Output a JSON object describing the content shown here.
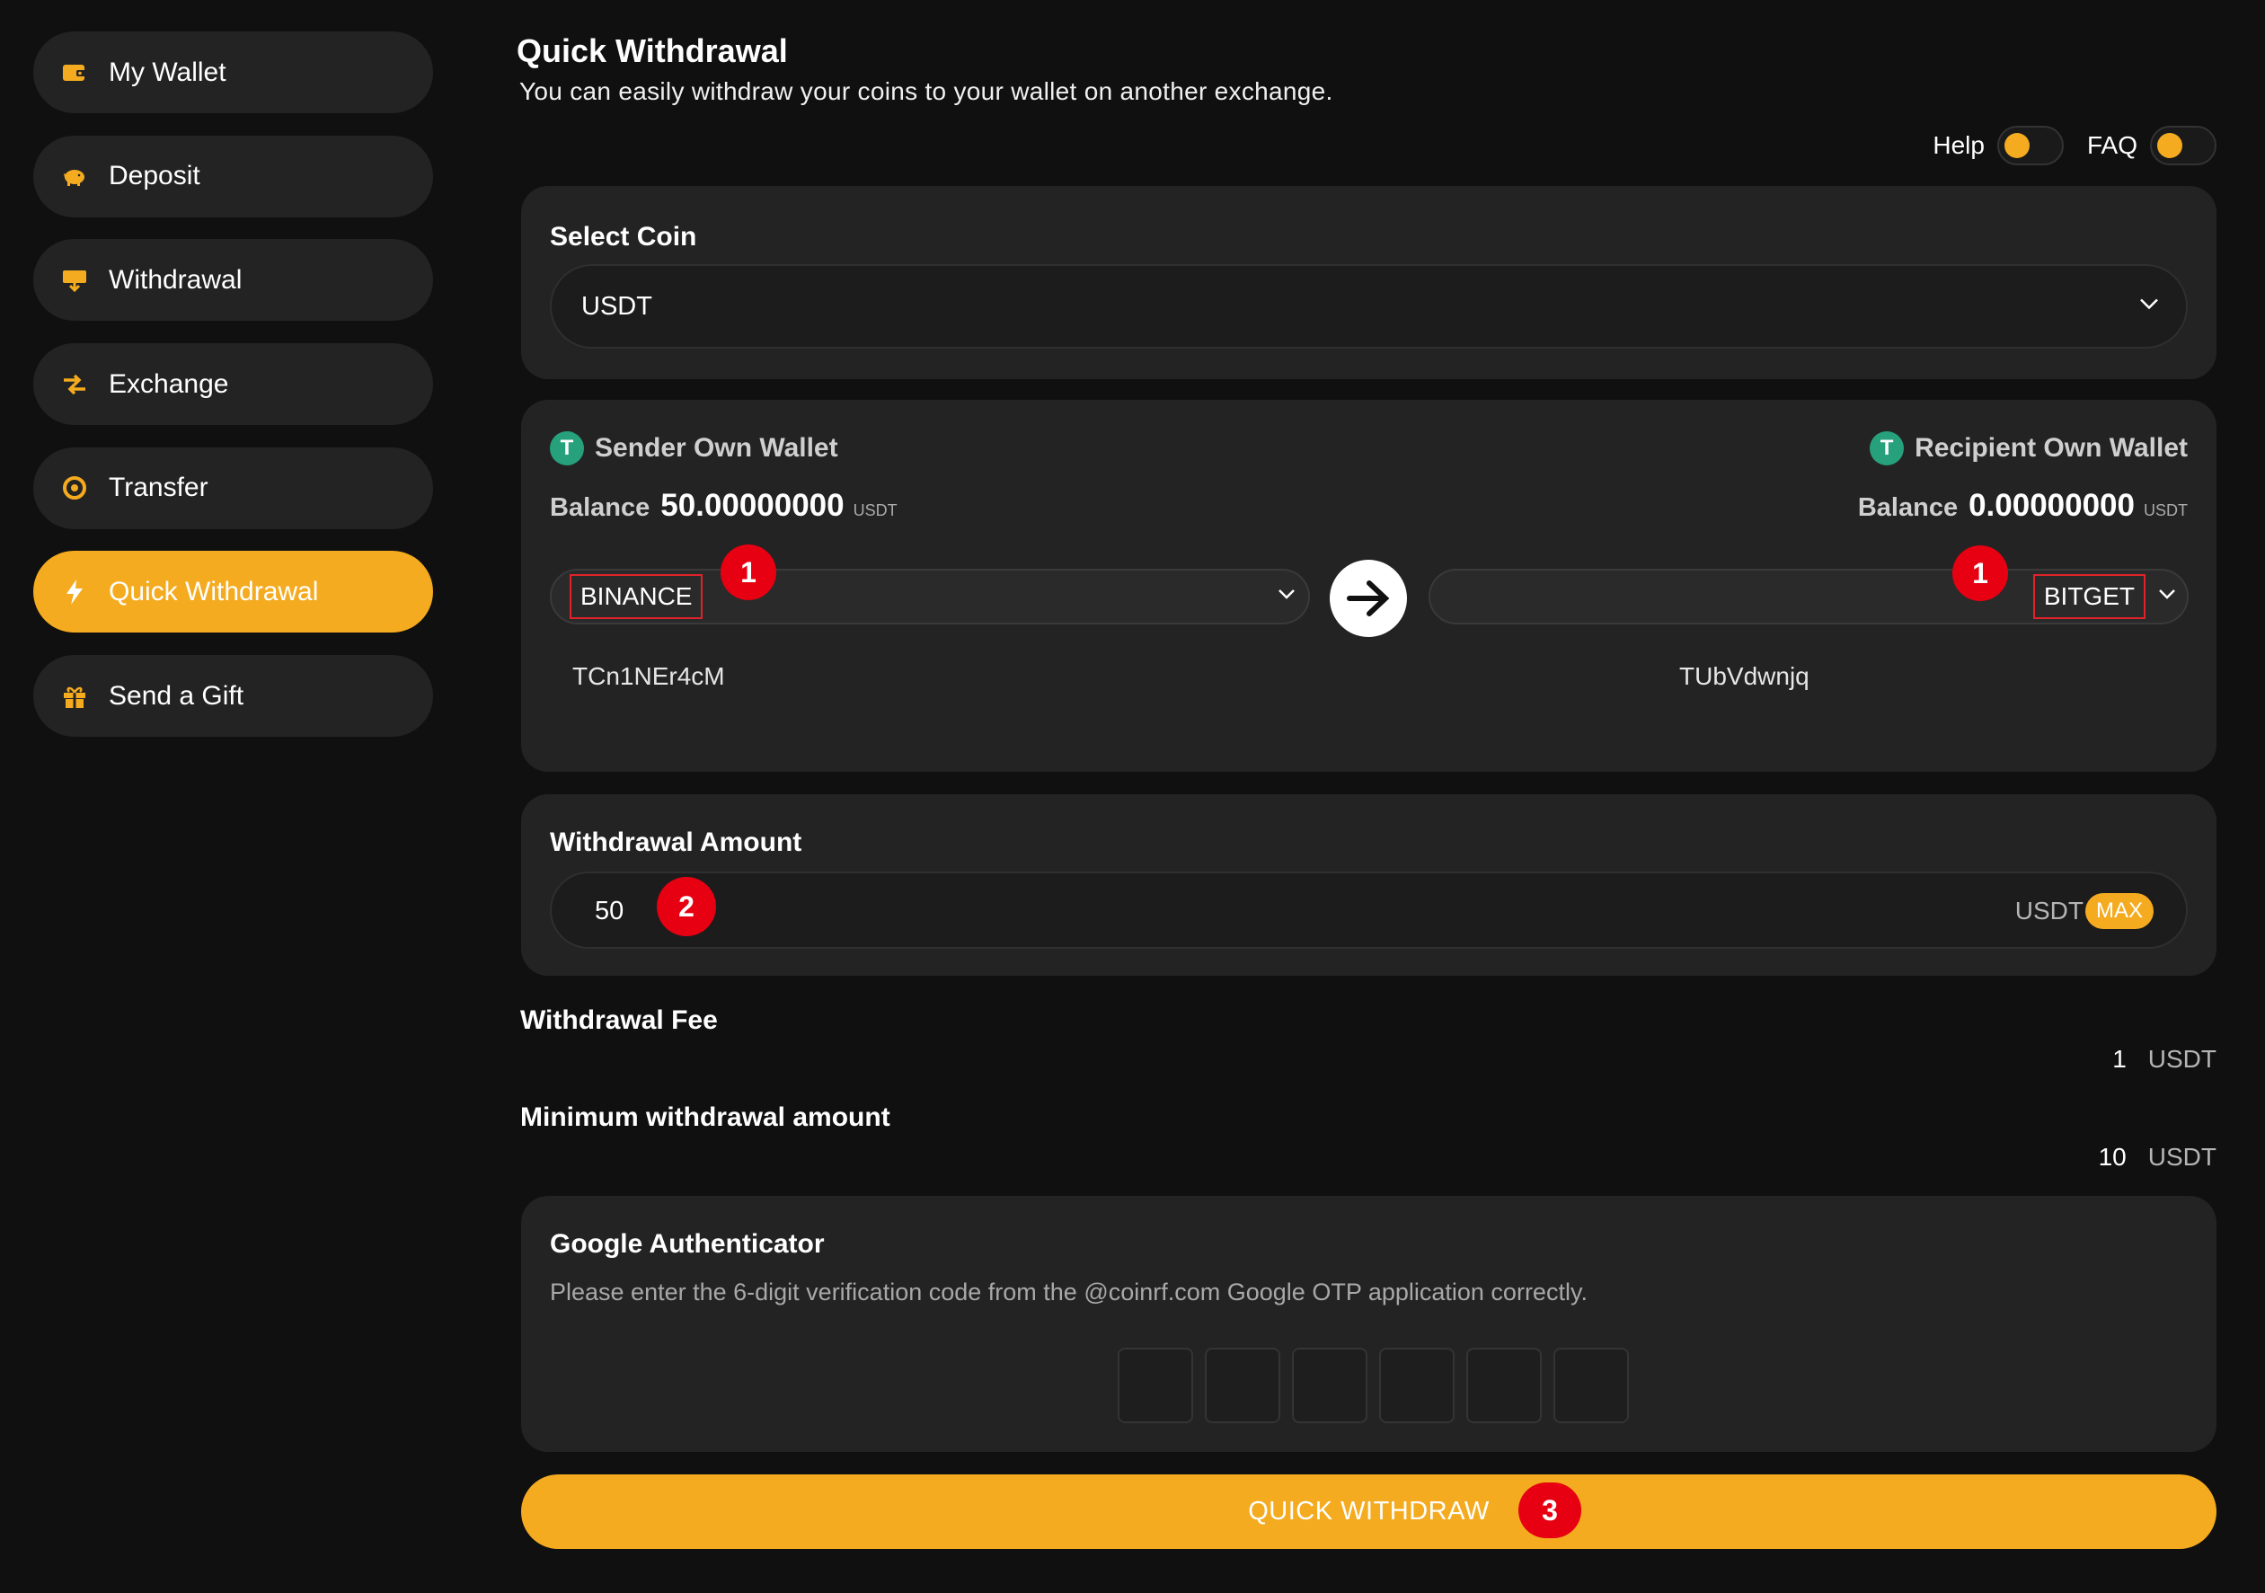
{
  "sidebar": {
    "items": [
      {
        "label": "My Wallet",
        "icon": "wallet-icon"
      },
      {
        "label": "Deposit",
        "icon": "piggy-bank-icon"
      },
      {
        "label": "Withdrawal",
        "icon": "withdraw-icon"
      },
      {
        "label": "Exchange",
        "icon": "exchange-arrows-icon"
      },
      {
        "label": "Transfer",
        "icon": "transfer-icon"
      },
      {
        "label": "Quick Withdrawal",
        "icon": "lightning-icon",
        "active": true
      },
      {
        "label": "Send a Gift",
        "icon": "gift-icon"
      }
    ]
  },
  "header": {
    "title": "Quick Withdrawal",
    "subtitle": "You can easily withdraw your coins to your wallet on another exchange."
  },
  "toggles": {
    "help_label": "Help",
    "faq_label": "FAQ"
  },
  "select_coin": {
    "label": "Select Coin",
    "value": "USDT"
  },
  "sender": {
    "title": "Sender Own Wallet",
    "balance_label": "Balance",
    "balance_value": "50.00000000",
    "balance_unit": "USDT",
    "exchange": "BINANCE",
    "address": "TCn1NEr4cM"
  },
  "recipient": {
    "title": "Recipient Own Wallet",
    "balance_label": "Balance",
    "balance_value": "0.00000000",
    "balance_unit": "USDT",
    "exchange": "BITGET",
    "address": "TUbVdwnjq"
  },
  "amount": {
    "label": "Withdrawal Amount",
    "value": "50",
    "unit": "USDT",
    "max_label": "MAX"
  },
  "fee": {
    "label": "Withdrawal Fee",
    "value": "1",
    "unit": "USDT"
  },
  "minimum": {
    "label": "Minimum withdrawal amount",
    "value": "10",
    "unit": "USDT"
  },
  "otp": {
    "title": "Google Authenticator",
    "description": "Please enter the 6-digit verification code from the @coinrf.com Google OTP application correctly."
  },
  "submit": {
    "label": "QUICK WITHDRAW"
  },
  "annotations": {
    "step1": "1",
    "step2": "2",
    "step3": "3"
  },
  "colors": {
    "accent": "#f5ab1f",
    "background": "#101010",
    "card": "#232323",
    "badge": "#e60012",
    "tether": "#26a17b"
  }
}
